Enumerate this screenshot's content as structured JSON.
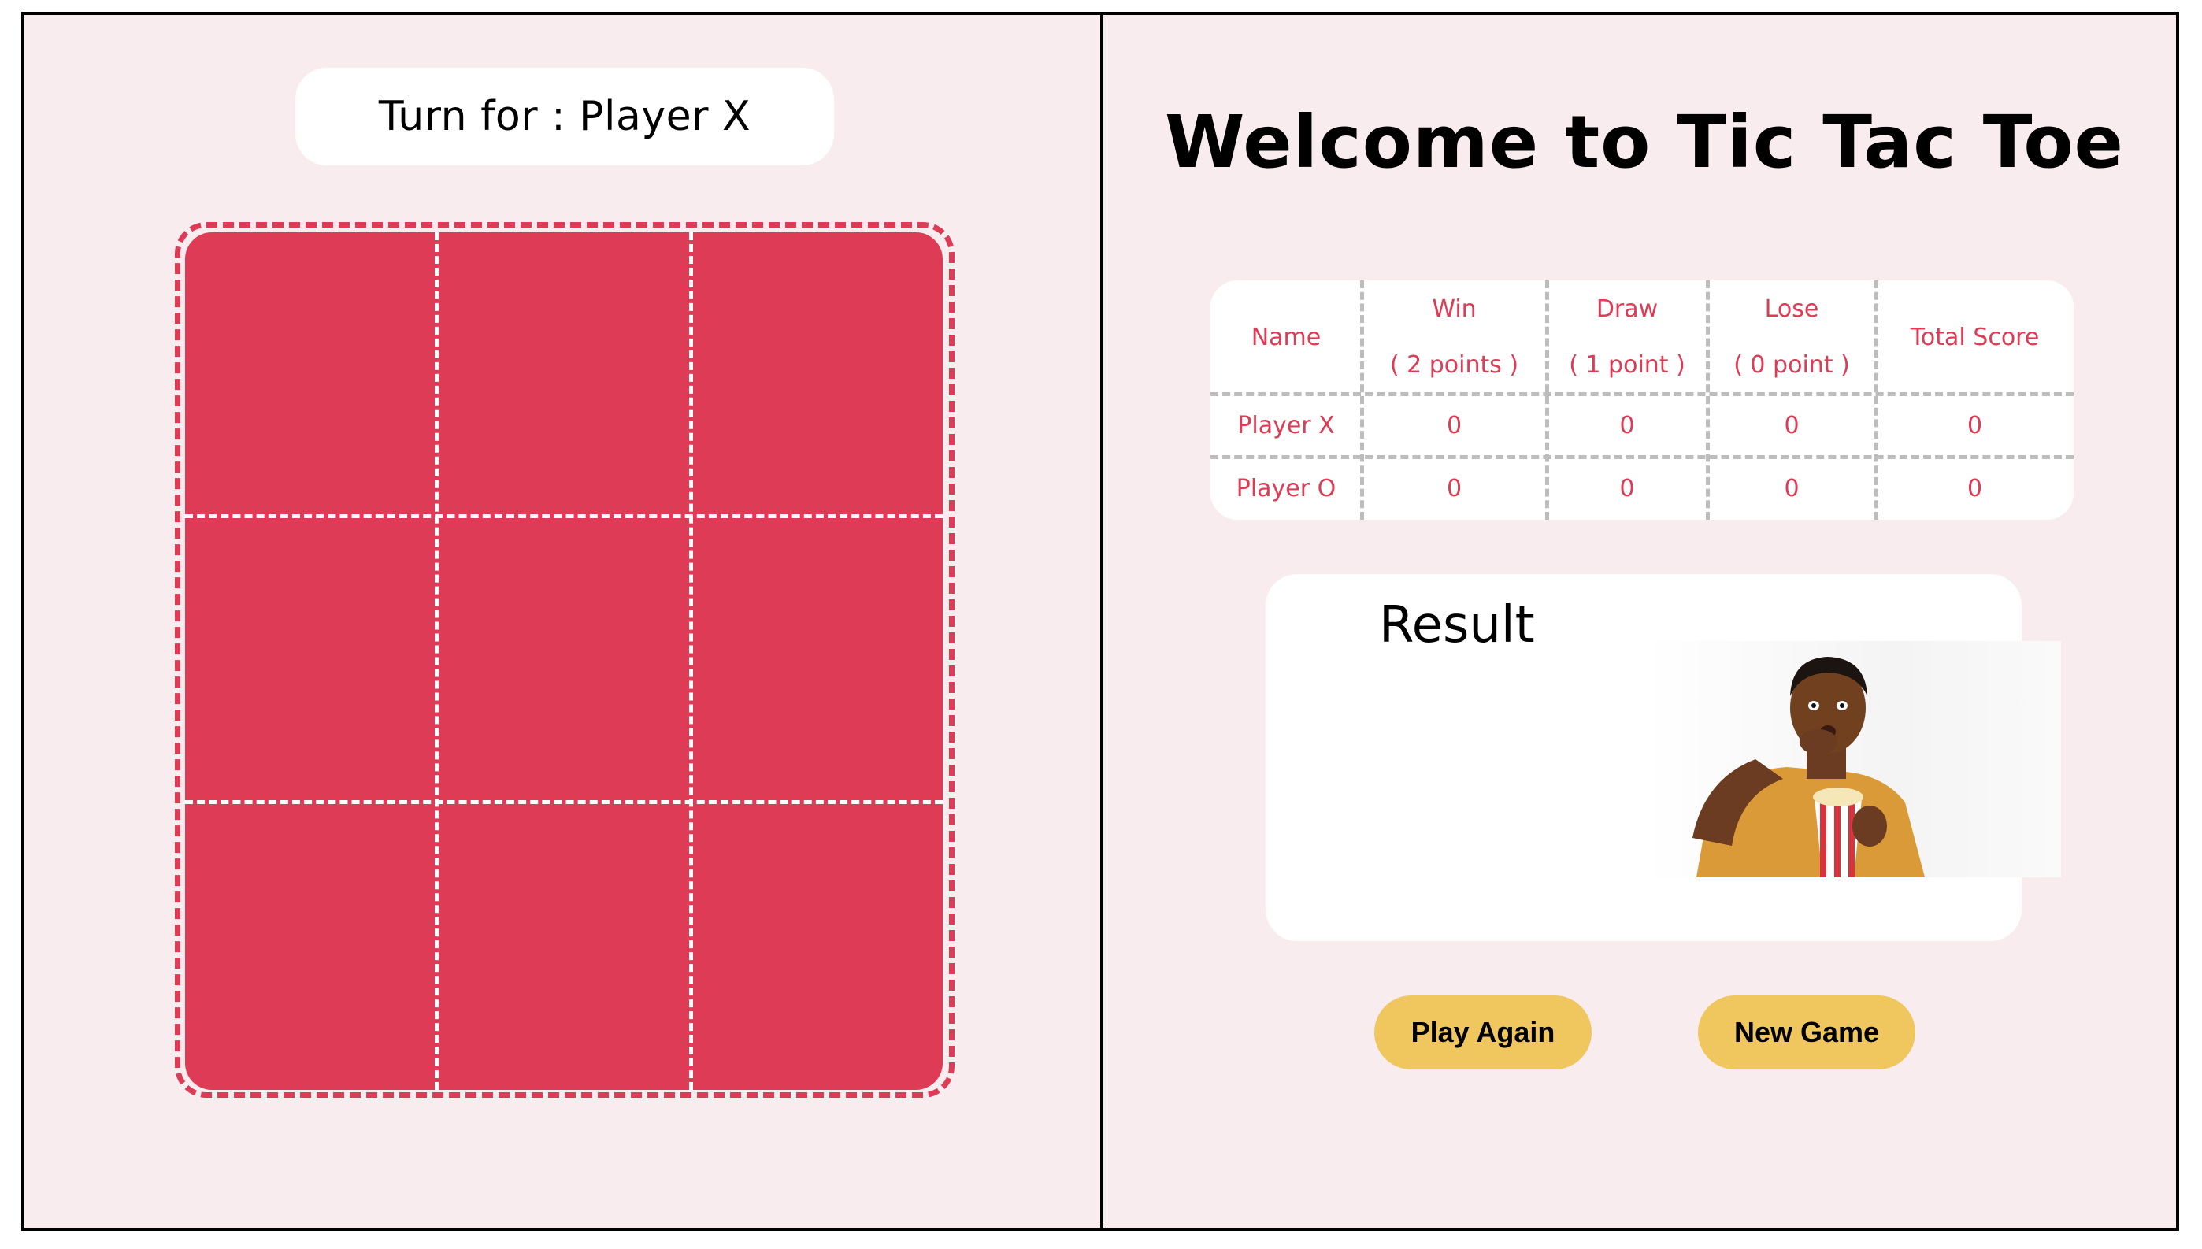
{
  "turn": {
    "label": "Turn for : Player X"
  },
  "board": {
    "cells": [
      "",
      "",
      "",
      "",
      "",
      "",
      "",
      "",
      ""
    ]
  },
  "title": "Welcome to Tic Tac Toe",
  "score_table": {
    "headers": [
      {
        "main": "Name",
        "sub": ""
      },
      {
        "main": "Win",
        "sub": "( 2 points )"
      },
      {
        "main": "Draw",
        "sub": "( 1 point )"
      },
      {
        "main": "Lose",
        "sub": "( 0 point )"
      },
      {
        "main": "Total Score",
        "sub": ""
      }
    ],
    "rows": [
      [
        "Player X",
        "0",
        "0",
        "0",
        "0"
      ],
      [
        "Player O",
        "0",
        "0",
        "0",
        "0"
      ]
    ]
  },
  "result": {
    "title": "Result",
    "image_alt": "man-eating-popcorn-gif"
  },
  "buttons": {
    "play_again": "Play Again",
    "new_game": "New Game"
  },
  "colors": {
    "panel_bg": "#f9ecef",
    "board": "#de3c56",
    "table_text": "#dc3c55",
    "button": "#f0c75e"
  }
}
